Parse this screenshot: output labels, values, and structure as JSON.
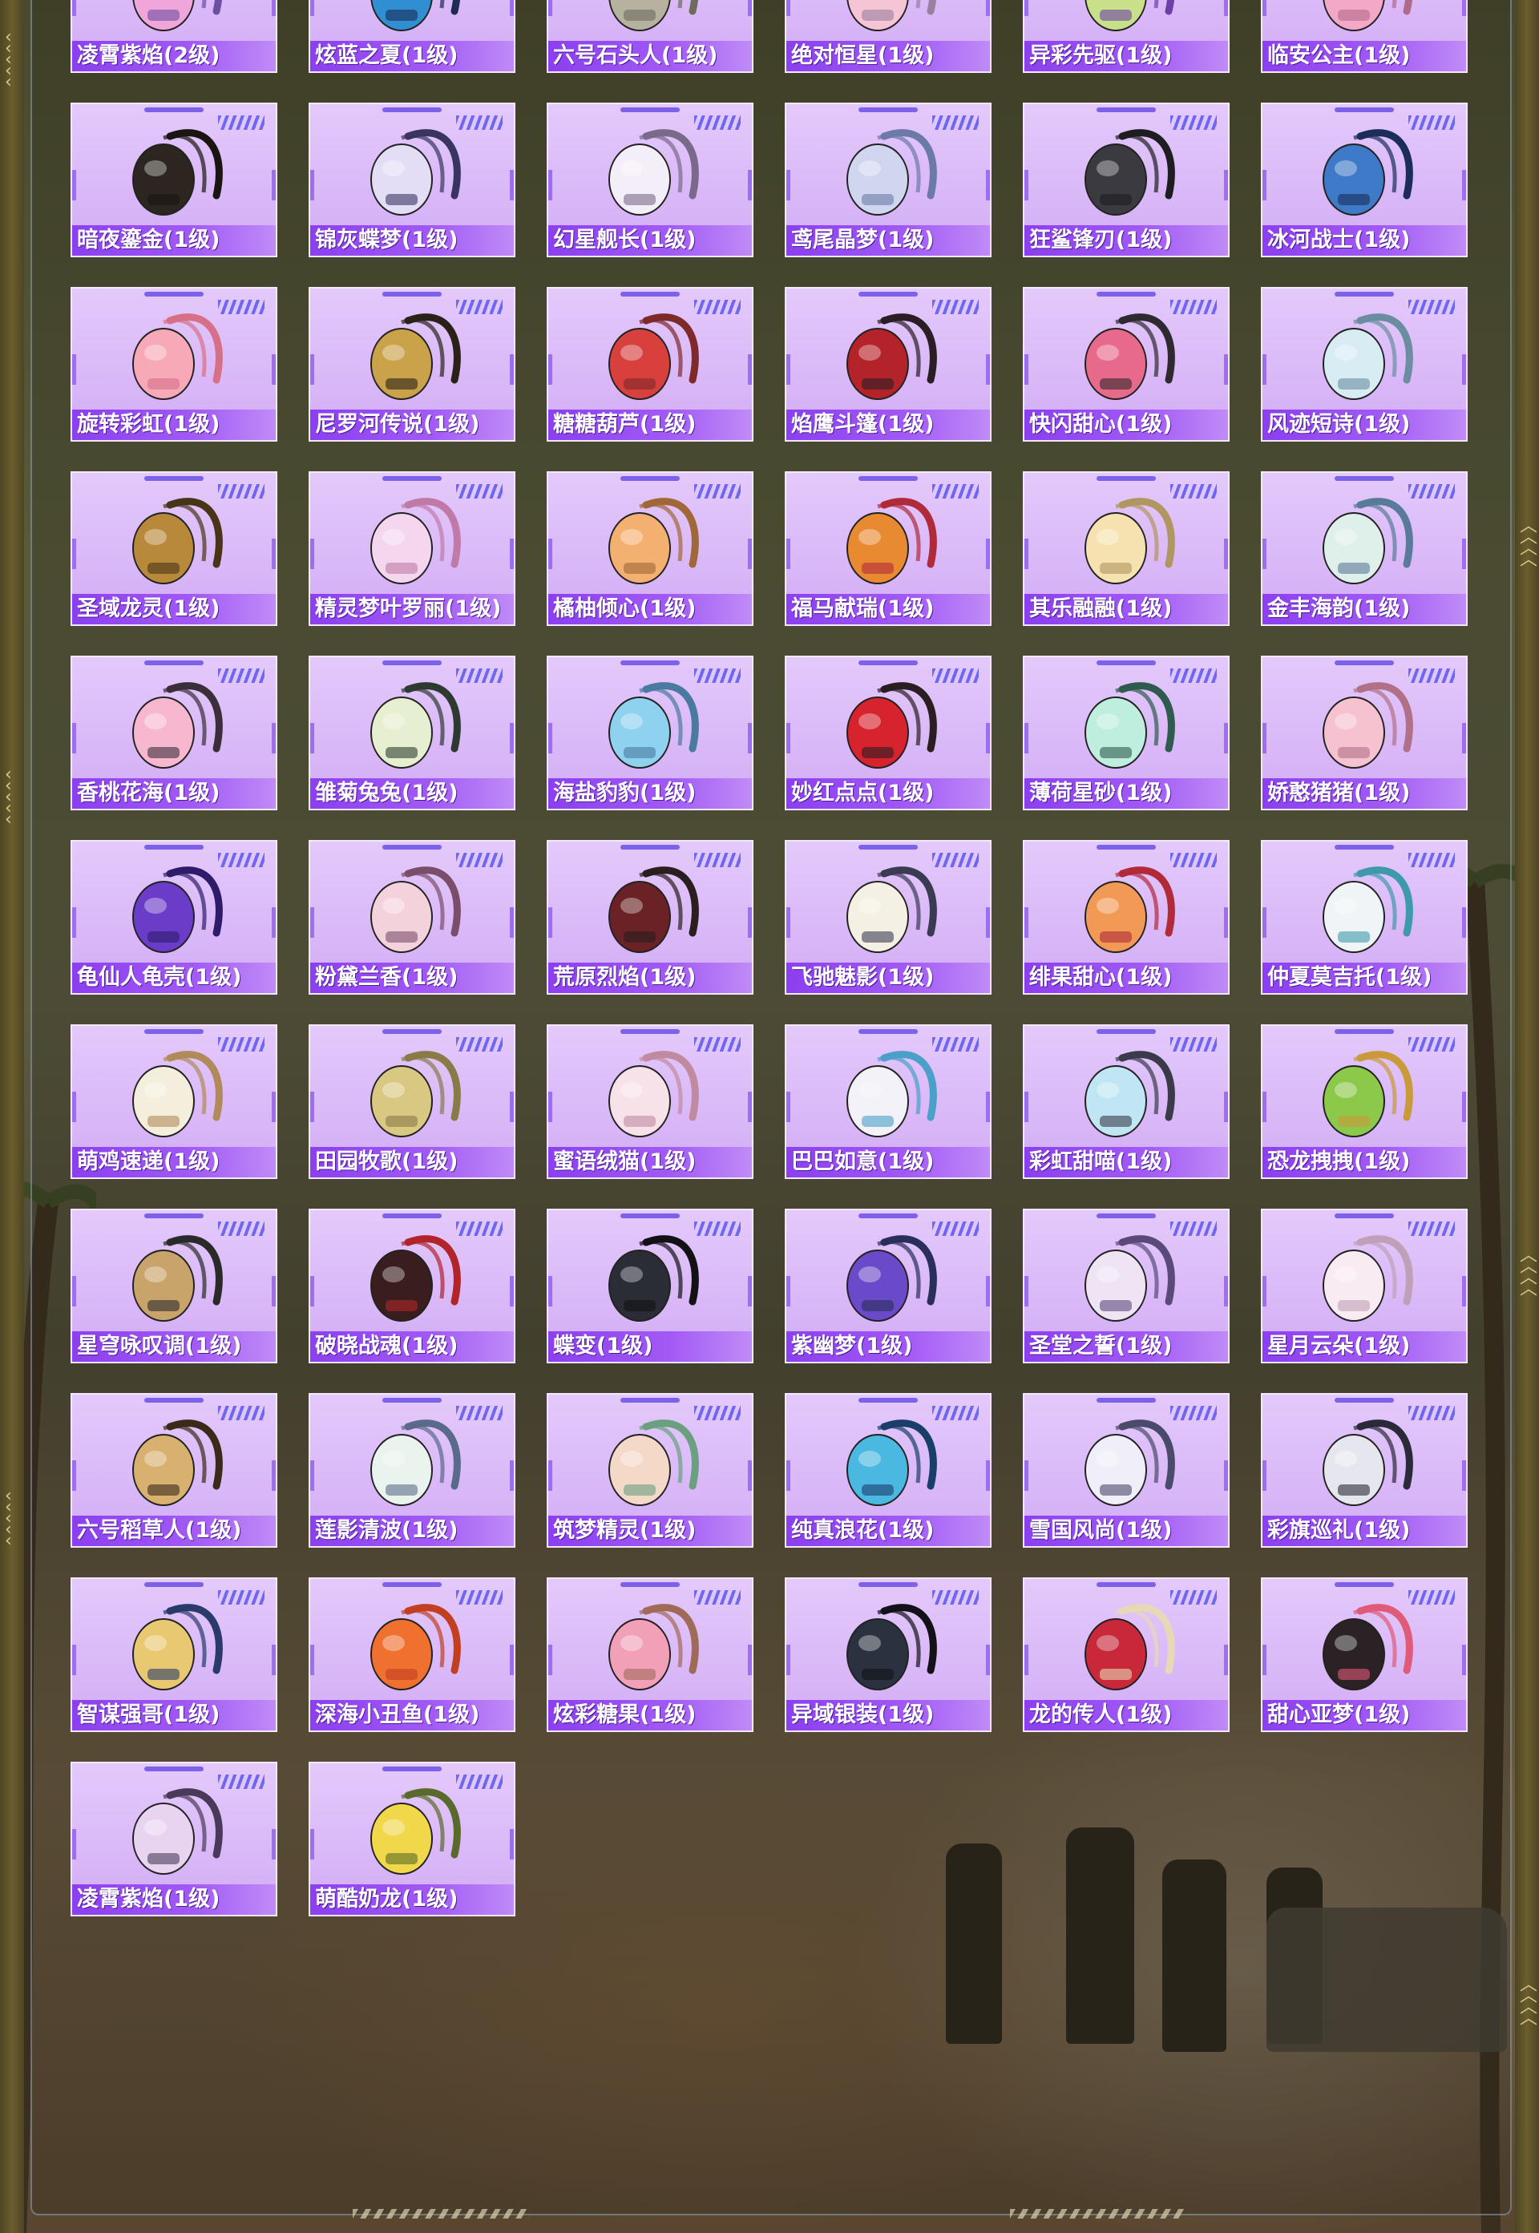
{
  "colors": {
    "card_bg": "#d8b5f7",
    "label_bg": "#8b3ff0",
    "accent_bar": "#7b62e8",
    "stripe": "#6d68f0",
    "frame_border": "#96aabe"
  },
  "rows": [
    {
      "items": [
        {
          "label": "凌霄紫焰(2级)",
          "icon": "backpack-flame-icon",
          "color": "#f0a6d8",
          "strap": "#6b4fa0"
        },
        {
          "label": "炫蓝之夏(1级)",
          "icon": "backpack-summer-icon",
          "color": "#2f8fd0",
          "strap": "#1d2b55"
        },
        {
          "label": "六号石头人(1级)",
          "icon": "backpack-stoneman-icon",
          "color": "#b7b2a0",
          "strap": "#6e6a5e"
        },
        {
          "label": "绝对恒星(1级)",
          "icon": "backpack-star-icon",
          "color": "#f5c4d5",
          "strap": "#9a7fa0"
        },
        {
          "label": "异彩先驱(1级)",
          "icon": "backpack-pioneer-icon",
          "color": "#c8e08a",
          "strap": "#6d3fa8"
        },
        {
          "label": "临安公主(1级)",
          "icon": "backpack-princess-icon",
          "color": "#f4a8c8",
          "strap": "#b06a8a"
        }
      ]
    },
    {
      "items": [
        {
          "label": "暗夜鎏金(1级)",
          "icon": "backpack-darkgold-icon",
          "color": "#2c2520",
          "strap": "#1a1512"
        },
        {
          "label": "锦灰蝶梦(1级)",
          "icon": "backpack-butterfly-icon",
          "color": "#e3ddf5",
          "strap": "#3a3560"
        },
        {
          "label": "幻星舰长(1级)",
          "icon": "backpack-captain-icon",
          "color": "#f4eef8",
          "strap": "#7a6a8a"
        },
        {
          "label": "鸢尾晶梦(1级)",
          "icon": "backpack-iris-icon",
          "color": "#cfd6ee",
          "strap": "#6c7aa8"
        },
        {
          "label": "狂鲨锋刃(1级)",
          "icon": "backpack-shark-icon",
          "color": "#3b3a40",
          "strap": "#1e1e22"
        },
        {
          "label": "冰河战士(1级)",
          "icon": "backpack-glacier-icon",
          "color": "#3e7ac8",
          "strap": "#1b2e5a"
        }
      ]
    },
    {
      "items": [
        {
          "label": "旋转彩虹(1级)",
          "icon": "backpack-rainbow-icon",
          "color": "#f7a9b8",
          "strap": "#d67088"
        },
        {
          "label": "尼罗河传说(1级)",
          "icon": "backpack-nile-icon",
          "color": "#c9a24a",
          "strap": "#2a2218"
        },
        {
          "label": "糖糖葫芦(1级)",
          "icon": "backpack-candy-icon",
          "color": "#d8403e",
          "strap": "#7e2a2a"
        },
        {
          "label": "焰鹰斗篷(1级)",
          "icon": "backpack-hawk-icon",
          "color": "#b5232a",
          "strap": "#2a1e24"
        },
        {
          "label": "快闪甜心(1级)",
          "icon": "backpack-sweetheart-icon",
          "color": "#e86a8a",
          "strap": "#2e2a30"
        },
        {
          "label": "风迹短诗(1级)",
          "icon": "backpack-poem-icon",
          "color": "#d8ecf4",
          "strap": "#6a8ea0"
        }
      ]
    },
    {
      "items": [
        {
          "label": "圣域龙灵(1级)",
          "icon": "backpack-dragon-icon",
          "color": "#b8893a",
          "strap": "#4a3418"
        },
        {
          "label": "精灵梦叶罗丽(1级)",
          "icon": "backpack-fairy-icon",
          "color": "#f4d6ee",
          "strap": "#c07aa8"
        },
        {
          "label": "橘柚倾心(1级)",
          "icon": "backpack-orange-icon",
          "color": "#f4b070",
          "strap": "#a06838"
        },
        {
          "label": "福马献瑞(1级)",
          "icon": "backpack-horse-icon",
          "color": "#e88a32",
          "strap": "#b02a3a"
        },
        {
          "label": "其乐融融(1级)",
          "icon": "backpack-joy-icon",
          "color": "#f6e2b0",
          "strap": "#b09660"
        },
        {
          "label": "金丰海韵(1级)",
          "icon": "backpack-sea-icon",
          "color": "#dff0ea",
          "strap": "#5a7a9a"
        }
      ]
    },
    {
      "items": [
        {
          "label": "香桃花海(1级)",
          "icon": "backpack-peach-icon",
          "color": "#f7b8cf",
          "strap": "#3a2e3a"
        },
        {
          "label": "雏菊兔兔(1级)",
          "icon": "backpack-daisy-icon",
          "color": "#e6efcf",
          "strap": "#2e3a30"
        },
        {
          "label": "海盐豹豹(1级)",
          "icon": "backpack-seasalt-icon",
          "color": "#8fd2ef",
          "strap": "#4a7aa0"
        },
        {
          "label": "妙红点点(1级)",
          "icon": "backpack-dots-icon",
          "color": "#d6232e",
          "strap": "#2a1e22"
        },
        {
          "label": "薄荷星砂(1级)",
          "icon": "backpack-mint-icon",
          "color": "#bdeede",
          "strap": "#2f5a4e"
        },
        {
          "label": "娇憨猪猪(1级)",
          "icon": "backpack-piggy-icon",
          "color": "#f6c2cf",
          "strap": "#b07088"
        }
      ]
    },
    {
      "items": [
        {
          "label": "龟仙人龟壳(1级)",
          "icon": "backpack-turtle-icon",
          "color": "#6a3cc8",
          "strap": "#2e1c6a"
        },
        {
          "label": "粉黛兰香(1级)",
          "icon": "backpack-orchid-icon",
          "color": "#f4d2dc",
          "strap": "#7a4e6a"
        },
        {
          "label": "荒原烈焰(1级)",
          "icon": "backpack-wasteland-icon",
          "color": "#6a2226",
          "strap": "#2a1e1e"
        },
        {
          "label": "飞驰魅影(1级)",
          "icon": "backpack-phantom-icon",
          "color": "#f4f0e4",
          "strap": "#3a3a52"
        },
        {
          "label": "绯果甜心(1级)",
          "icon": "backpack-fruit-icon",
          "color": "#f09a56",
          "strap": "#b02a3a"
        },
        {
          "label": "仲夏莫吉托(1级)",
          "icon": "backpack-mojito-icon",
          "color": "#f0f4f6",
          "strap": "#3e9aaa"
        }
      ]
    },
    {
      "items": [
        {
          "label": "萌鸡速递(1级)",
          "icon": "backpack-chick-icon",
          "color": "#f4eedd",
          "strap": "#b08a5a"
        },
        {
          "label": "田园牧歌(1级)",
          "icon": "backpack-pastoral-icon",
          "color": "#d8c882",
          "strap": "#8a7a48"
        },
        {
          "label": "蜜语绒猫(1级)",
          "icon": "backpack-cat-icon",
          "color": "#f8e2ea",
          "strap": "#c08aa0"
        },
        {
          "label": "巴巴如意(1级)",
          "icon": "backpack-ruyi-icon",
          "color": "#f2f2f8",
          "strap": "#4aa0c8"
        },
        {
          "label": "彩虹甜喵(1级)",
          "icon": "backpack-rainbowcat-icon",
          "color": "#bfe6f2",
          "strap": "#3a3a4a"
        },
        {
          "label": "恐龙拽拽(1级)",
          "icon": "backpack-dino-icon",
          "color": "#8cc84a",
          "strap": "#c89a3a"
        }
      ]
    },
    {
      "items": [
        {
          "label": "星穹咏叹调(1级)",
          "icon": "backpack-aria-icon",
          "color": "#c8a46a",
          "strap": "#2a2a2a"
        },
        {
          "label": "破晓战魂(1级)",
          "icon": "backpack-dawn-icon",
          "color": "#3a1e1e",
          "strap": "#b0242a"
        },
        {
          "label": "蝶变(1级)",
          "icon": "backpack-metamorph-icon",
          "color": "#2a2c36",
          "strap": "#121216"
        },
        {
          "label": "紫幽梦(1级)",
          "icon": "backpack-violet-icon",
          "color": "#6a4ac8",
          "strap": "#2a2e5a"
        },
        {
          "label": "圣堂之誓(1级)",
          "icon": "backpack-oath-icon",
          "color": "#eee4f4",
          "strap": "#5a4a7a"
        },
        {
          "label": "星月云朵(1级)",
          "icon": "backpack-cloud-icon",
          "color": "#f8ecf2",
          "strap": "#c0a0b8"
        }
      ]
    },
    {
      "items": [
        {
          "label": "六号稻草人(1级)",
          "icon": "backpack-scarecrow-icon",
          "color": "#d8b070",
          "strap": "#3a2a1a"
        },
        {
          "label": "莲影清波(1级)",
          "icon": "backpack-lotus-icon",
          "color": "#eaf4ee",
          "strap": "#5a6a8a"
        },
        {
          "label": "筑梦精灵(1级)",
          "icon": "backpack-dreamelf-icon",
          "color": "#f4d8c8",
          "strap": "#6aa080"
        },
        {
          "label": "纯真浪花(1级)",
          "icon": "backpack-wave-icon",
          "color": "#4ab8e0",
          "strap": "#1a3e6a"
        },
        {
          "label": "雪国风尚(1级)",
          "icon": "backpack-snow-icon",
          "color": "#f0eef8",
          "strap": "#4a4a6a"
        },
        {
          "label": "彩旗巡礼(1级)",
          "icon": "backpack-flag-icon",
          "color": "#e6e6ee",
          "strap": "#2a2a3a"
        }
      ]
    },
    {
      "items": [
        {
          "label": "智谋强哥(1级)",
          "icon": "backpack-strongbro-icon",
          "color": "#e8c870",
          "strap": "#2a3a6a"
        },
        {
          "label": "深海小丑鱼(1级)",
          "icon": "backpack-clownfish-icon",
          "color": "#f07030",
          "strap": "#c04020"
        },
        {
          "label": "炫彩糖果(1级)",
          "icon": "backpack-donut-icon",
          "color": "#f2a0b8",
          "strap": "#a06a58"
        },
        {
          "label": "异域银装(1级)",
          "icon": "backpack-silver-icon",
          "color": "#2a3240",
          "strap": "#121218"
        },
        {
          "label": "龙的传人(1级)",
          "icon": "backpack-heir-icon",
          "color": "#c8283a",
          "strap": "#e8d8b8"
        },
        {
          "label": "甜心亚梦(1级)",
          "icon": "backpack-amu-icon",
          "color": "#2a2224",
          "strap": "#e05a7a"
        }
      ]
    },
    {
      "items": [
        {
          "label": "凌霄紫焰(1级)",
          "icon": "backpack-flame-icon",
          "color": "#e8d4f0",
          "strap": "#4a3a5a"
        },
        {
          "label": "萌酷奶龙(1级)",
          "icon": "backpack-milkdragon-icon",
          "color": "#f0d84a",
          "strap": "#5a6a2a"
        }
      ]
    }
  ]
}
